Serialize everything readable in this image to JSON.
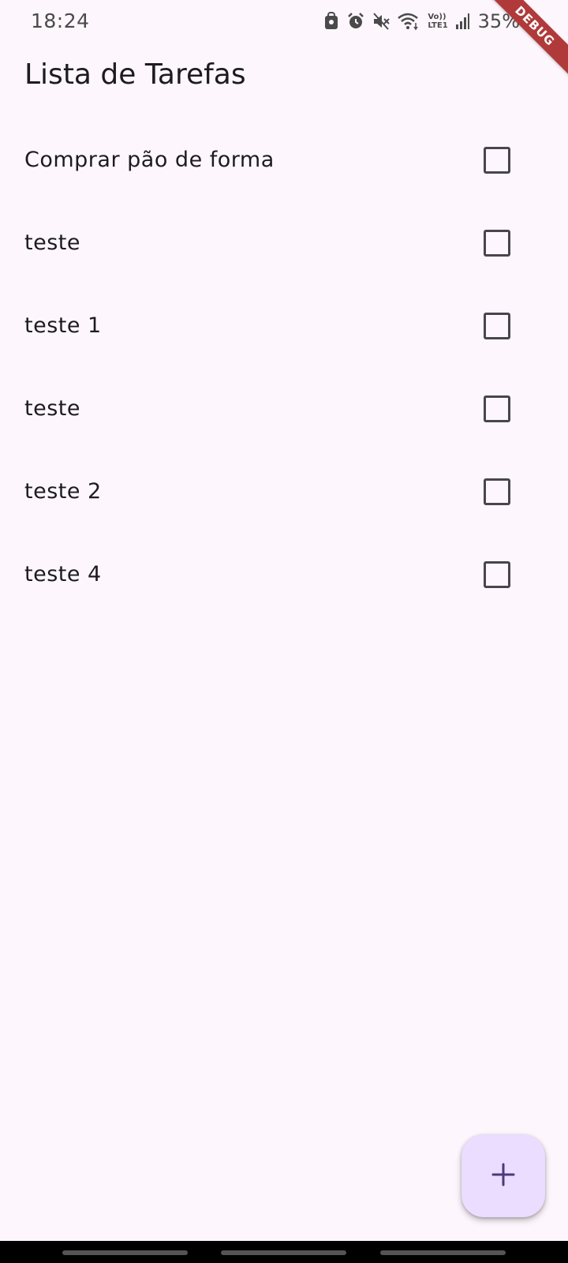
{
  "status_bar": {
    "time": "18:24",
    "battery_percent": "35%",
    "icons": [
      "vpn-lock-icon",
      "alarm-icon",
      "mute-icon",
      "wifi-icon",
      "volte-icon",
      "signal-icon",
      "battery-icon"
    ],
    "volte_label_top": "Vo))",
    "volte_label_bottom": "LTE1"
  },
  "debug_banner": "DEBUG",
  "app_bar": {
    "title": "Lista de Tarefas"
  },
  "tasks": [
    {
      "label": "Comprar pão de forma",
      "checked": false
    },
    {
      "label": "teste",
      "checked": false
    },
    {
      "label": "teste 1",
      "checked": false
    },
    {
      "label": "teste",
      "checked": false
    },
    {
      "label": "teste 2",
      "checked": false
    },
    {
      "label": "teste 4",
      "checked": false
    }
  ],
  "fab": {
    "icon": "plus-icon"
  },
  "colors": {
    "background": "#fdf7fd",
    "fab_background": "#eaddff",
    "fab_icon": "#4a3a7a",
    "checkbox_border": "#49454f",
    "debug_banner": "#b03a3a"
  }
}
